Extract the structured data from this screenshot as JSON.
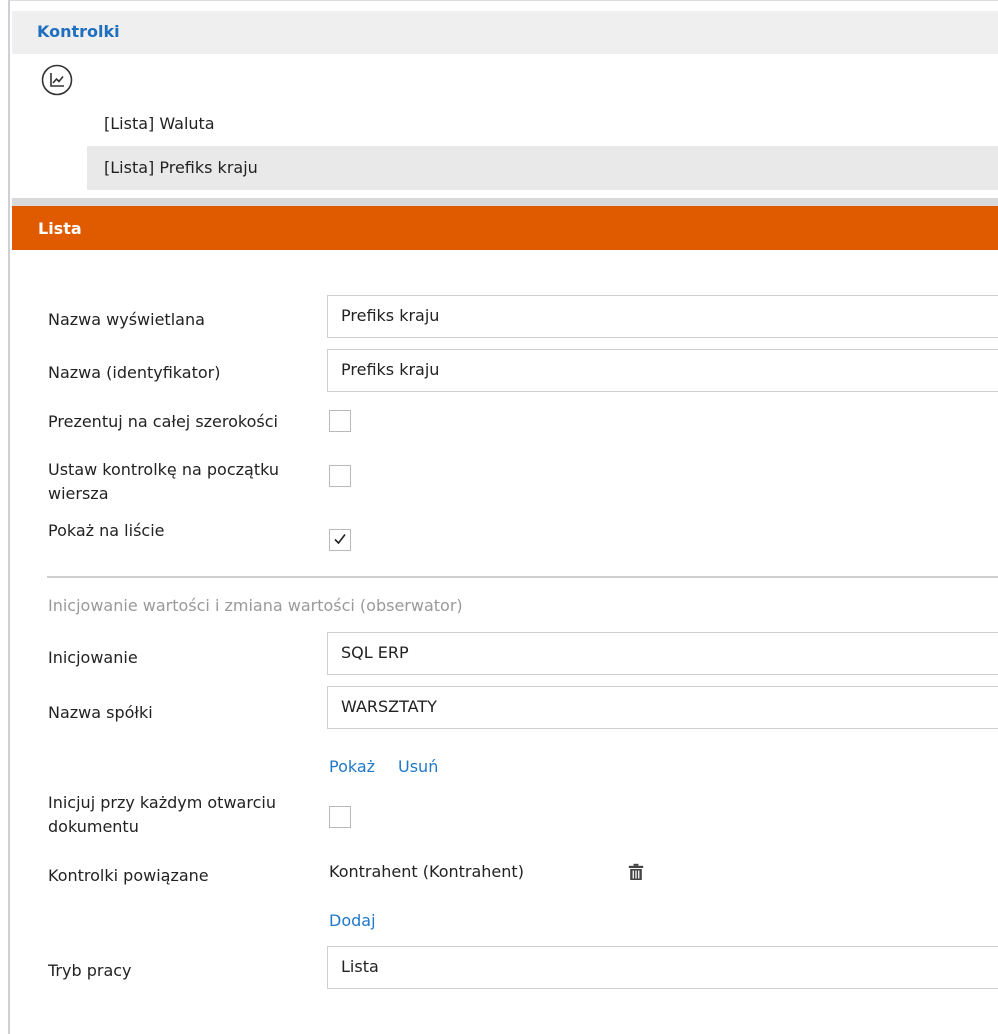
{
  "kontrolki_panel": {
    "title": "Kontrolki",
    "items": [
      {
        "label": "[Lista] Waluta",
        "selected": false
      },
      {
        "label": "[Lista] Prefiks kraju",
        "selected": true
      }
    ]
  },
  "lista_panel": {
    "title": "Lista",
    "fields": {
      "display_name": {
        "label": "Nazwa wyświetlana",
        "value": "Prefiks kraju"
      },
      "identifier": {
        "label": "Nazwa (identyfikator)",
        "value": "Prefiks kraju"
      },
      "full_width": {
        "label": "Prezentuj na całej szerokości",
        "checked": false
      },
      "row_start": {
        "label_line1": "Ustaw kontrolkę na początku",
        "label_line2": "wiersza",
        "checked": false
      },
      "show_on_list": {
        "label": "Pokaż na liście",
        "checked": true
      }
    },
    "observer_section": {
      "caption": "Inicjowanie wartości i zmiana wartości (obserwator)",
      "init": {
        "label": "Inicjowanie",
        "value": "SQL ERP"
      },
      "company": {
        "label": "Nazwa spółki",
        "value": "WARSZTATY"
      },
      "show_link": "Pokaż",
      "remove_link": "Usuń",
      "init_each_open": {
        "label_line1": "Inicjuj przy każdym otwarciu",
        "label_line2": "dokumentu",
        "checked": false
      },
      "related": {
        "label": "Kontrolki powiązane",
        "value": "Kontrahent (Kontrahent)"
      },
      "add_link": "Dodaj",
      "mode": {
        "label": "Tryb pracy",
        "value": "Lista"
      }
    }
  },
  "colors": {
    "accent_orange": "#e05a00",
    "link_blue": "#1f78c8",
    "header_blue": "#1f6fbf"
  },
  "icons": [
    "line-chart-icon",
    "checkmark-icon",
    "trash-icon"
  ]
}
